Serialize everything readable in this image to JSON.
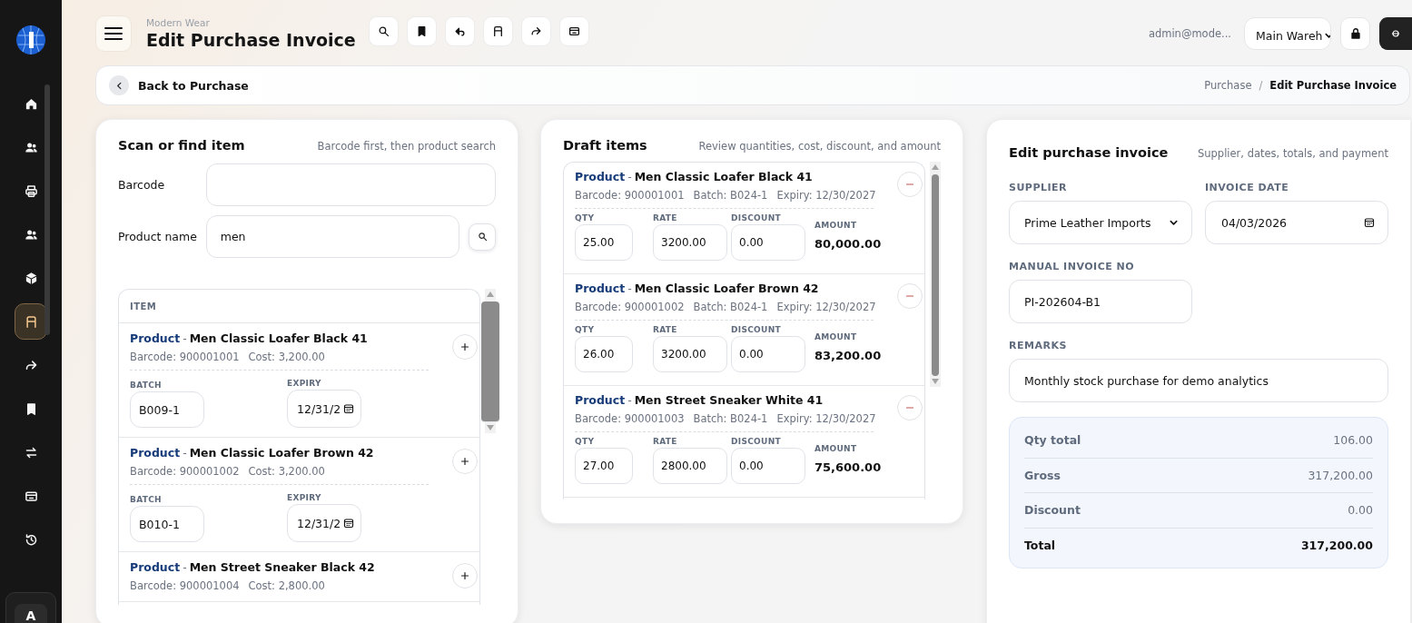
{
  "sidebar": {
    "items": [
      {
        "selected": false
      },
      {
        "selected": false
      },
      {
        "selected": false
      },
      {
        "selected": false
      },
      {
        "selected": false
      },
      {
        "selected": true
      },
      {
        "selected": false
      },
      {
        "selected": false
      },
      {
        "selected": false
      },
      {
        "selected": false
      },
      {
        "selected": false
      }
    ],
    "avatar": "A"
  },
  "header": {
    "company": "Modern Wear",
    "title": "Edit Purchase Invoice",
    "user": "admin@mode...",
    "warehouse": "Main Wareh"
  },
  "breadcrumb": {
    "back": "Back to Purchase",
    "crumbs": [
      "Purchase",
      "Edit Purchase Invoice"
    ],
    "separator": "/"
  },
  "scan": {
    "title": "Scan or find item",
    "subtitle": "Barcode first, then product search",
    "barcode": {
      "label": "Barcode"
    },
    "product_name": {
      "label": "Product name",
      "value": "men"
    },
    "column": "ITEM",
    "items": [
      {
        "prefix": "Product",
        "separator": "-",
        "name": "Men Classic Loafer Black 41",
        "barcode": "Barcode: 900001001",
        "cost": "Cost: 3,200.00",
        "batch": {
          "label": "BATCH",
          "value": "B009-1"
        },
        "expiry": {
          "label": "EXPIRY",
          "value": "12/31/2"
        }
      },
      {
        "prefix": "Product",
        "separator": "-",
        "name": "Men Classic Loafer Brown 42",
        "barcode": "Barcode: 900001002",
        "cost": "Cost: 3,200.00",
        "batch": {
          "label": "BATCH",
          "value": "B010-1"
        },
        "expiry": {
          "label": "EXPIRY",
          "value": "12/31/2"
        }
      },
      {
        "prefix": "Product",
        "separator": "-",
        "name": "Men Street Sneaker Black 42",
        "barcode": "Barcode: 900001004",
        "cost": "Cost: 2,800.00"
      }
    ]
  },
  "draft": {
    "title": "Draft items",
    "subtitle": "Review quantities, cost, discount, and amount",
    "items": [
      {
        "prefix": "Product",
        "separator": "-",
        "name": "Men Classic Loafer Black 41",
        "meta": [
          "Barcode: 900001001",
          "Batch: B024-1",
          "Expiry: 12/30/2027"
        ],
        "fields": [
          {
            "label": "QTY",
            "value": "25.00"
          },
          {
            "label": "RATE",
            "value": "3200.00"
          },
          {
            "label": "DISCOUNT",
            "value": "0.00"
          }
        ],
        "amount": {
          "label": "AMOUNT",
          "value": "80,000.00"
        }
      },
      {
        "prefix": "Product",
        "separator": "-",
        "name": "Men Classic Loafer Brown 42",
        "meta": [
          "Barcode: 900001002",
          "Batch: B024-1",
          "Expiry: 12/30/2027"
        ],
        "fields": [
          {
            "label": "QTY",
            "value": "26.00"
          },
          {
            "label": "RATE",
            "value": "3200.00"
          },
          {
            "label": "DISCOUNT",
            "value": "0.00"
          }
        ],
        "amount": {
          "label": "AMOUNT",
          "value": "83,200.00"
        }
      },
      {
        "prefix": "Product",
        "separator": "-",
        "name": "Men Street Sneaker White 41",
        "meta": [
          "Barcode: 900001003",
          "Batch: B024-1",
          "Expiry: 12/30/2027"
        ],
        "fields": [
          {
            "label": "QTY",
            "value": "27.00"
          },
          {
            "label": "RATE",
            "value": "2800.00"
          },
          {
            "label": "DISCOUNT",
            "value": "0.00"
          }
        ],
        "amount": {
          "label": "AMOUNT",
          "value": "75,600.00"
        }
      }
    ]
  },
  "invoice": {
    "title": "Edit purchase invoice",
    "subtitle": "Supplier, dates, totals, and payment",
    "fields": [
      {
        "kind": "select",
        "label": "SUPPLIER",
        "value": "Prime Leather Imports"
      },
      {
        "kind": "date",
        "label": "INVOICE DATE",
        "value": "04/03/2026"
      },
      {
        "kind": "text",
        "label": "MANUAL INVOICE NO",
        "value": "PI-202604-B1"
      },
      {
        "kind": "wide",
        "label": "REMARKS",
        "value": "Monthly stock purchase for demo analytics"
      }
    ],
    "summary": [
      {
        "kind": "line",
        "label": "Qty total",
        "value": "106.00"
      },
      {
        "kind": "line",
        "label": "Gross",
        "value": "317,200.00"
      },
      {
        "kind": "line",
        "label": "Discount",
        "value": "0.00"
      },
      {
        "kind": "total",
        "label": "Total",
        "value": "317,200.00"
      }
    ]
  }
}
